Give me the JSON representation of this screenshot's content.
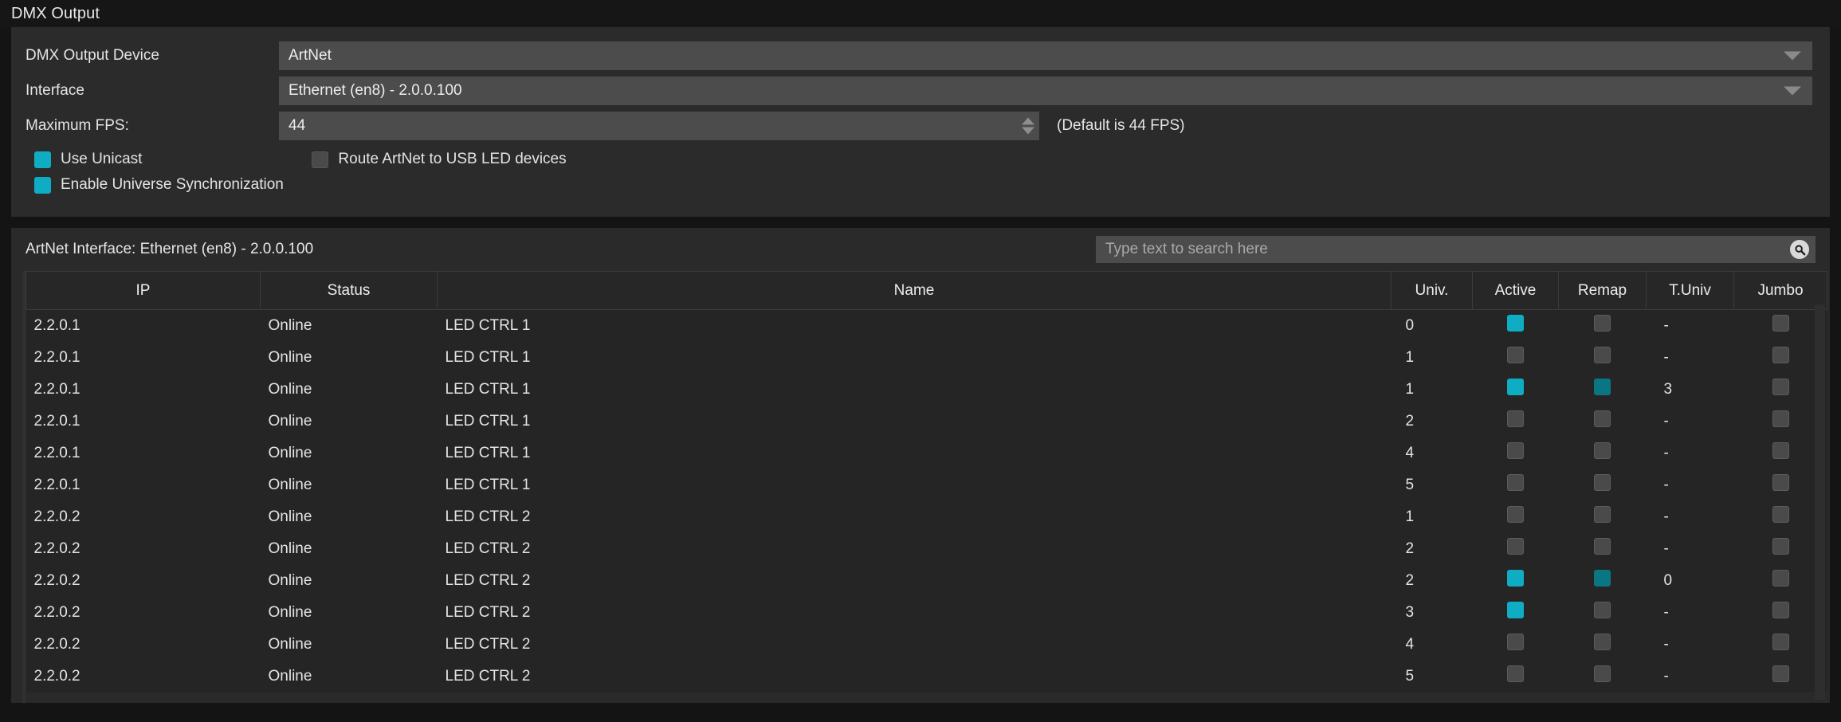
{
  "window": {
    "title": "DMX Output"
  },
  "settings": {
    "rows": [
      {
        "label": "DMX Output Device",
        "value": "ArtNet",
        "control": "dropdown"
      },
      {
        "label": "Interface",
        "value": "Ethernet (en8) - 2.0.0.100",
        "control": "dropdown"
      },
      {
        "label": "Maximum FPS:",
        "value": "44",
        "control": "spinner"
      }
    ],
    "fps_hint": "(Default is 44 FPS)",
    "checkboxes": [
      {
        "label": "Use Unicast",
        "checked": true
      },
      {
        "label": "Route ArtNet to USB LED devices",
        "checked": false
      },
      {
        "label": "Enable Universe Synchronization",
        "checked": true
      }
    ]
  },
  "interface_panel": {
    "title": "ArtNet Interface: Ethernet (en8) - 2.0.0.100",
    "search": {
      "value": "",
      "placeholder": "Type text to search here",
      "icon": "search-icon"
    },
    "columns": [
      "IP",
      "Status",
      "Name",
      "Univ.",
      "Active",
      "Remap",
      "T.Univ",
      "Jumbo"
    ],
    "rows": [
      {
        "ip": "2.2.0.1",
        "status": "Online",
        "name": "LED CTRL 1",
        "univ": "0",
        "active": true,
        "remap": false,
        "tuniv": "-",
        "jumbo": false
      },
      {
        "ip": "2.2.0.1",
        "status": "Online",
        "name": "LED CTRL 1",
        "univ": "1",
        "active": false,
        "remap": false,
        "tuniv": "-",
        "jumbo": false
      },
      {
        "ip": "2.2.0.1",
        "status": "Online",
        "name": "LED CTRL 1",
        "univ": "1",
        "active": true,
        "remap": true,
        "tuniv": "3",
        "jumbo": false
      },
      {
        "ip": "2.2.0.1",
        "status": "Online",
        "name": "LED CTRL 1",
        "univ": "2",
        "active": false,
        "remap": false,
        "tuniv": "-",
        "jumbo": false
      },
      {
        "ip": "2.2.0.1",
        "status": "Online",
        "name": "LED CTRL 1",
        "univ": "4",
        "active": false,
        "remap": false,
        "tuniv": "-",
        "jumbo": false
      },
      {
        "ip": "2.2.0.1",
        "status": "Online",
        "name": "LED CTRL 1",
        "univ": "5",
        "active": false,
        "remap": false,
        "tuniv": "-",
        "jumbo": false
      },
      {
        "ip": "2.2.0.2",
        "status": "Online",
        "name": "LED CTRL 2",
        "univ": "1",
        "active": false,
        "remap": false,
        "tuniv": "-",
        "jumbo": false
      },
      {
        "ip": "2.2.0.2",
        "status": "Online",
        "name": "LED CTRL 2",
        "univ": "2",
        "active": false,
        "remap": false,
        "tuniv": "-",
        "jumbo": false
      },
      {
        "ip": "2.2.0.2",
        "status": "Online",
        "name": "LED CTRL 2",
        "univ": "2",
        "active": true,
        "remap": true,
        "tuniv": "0",
        "jumbo": false
      },
      {
        "ip": "2.2.0.2",
        "status": "Online",
        "name": "LED CTRL 2",
        "univ": "3",
        "active": true,
        "remap": false,
        "tuniv": "-",
        "jumbo": false
      },
      {
        "ip": "2.2.0.2",
        "status": "Online",
        "name": "LED CTRL 2",
        "univ": "4",
        "active": false,
        "remap": false,
        "tuniv": "-",
        "jumbo": false
      },
      {
        "ip": "2.2.0.2",
        "status": "Online",
        "name": "LED CTRL 2",
        "univ": "5",
        "active": false,
        "remap": false,
        "tuniv": "-",
        "jumbo": false
      }
    ]
  },
  "colors": {
    "accent": "#0fadc4",
    "accent_dark": "#0a7583",
    "panel_bg": "#2b2b2b",
    "field_bg": "#4c4c4c",
    "table_bg": "#252525"
  }
}
